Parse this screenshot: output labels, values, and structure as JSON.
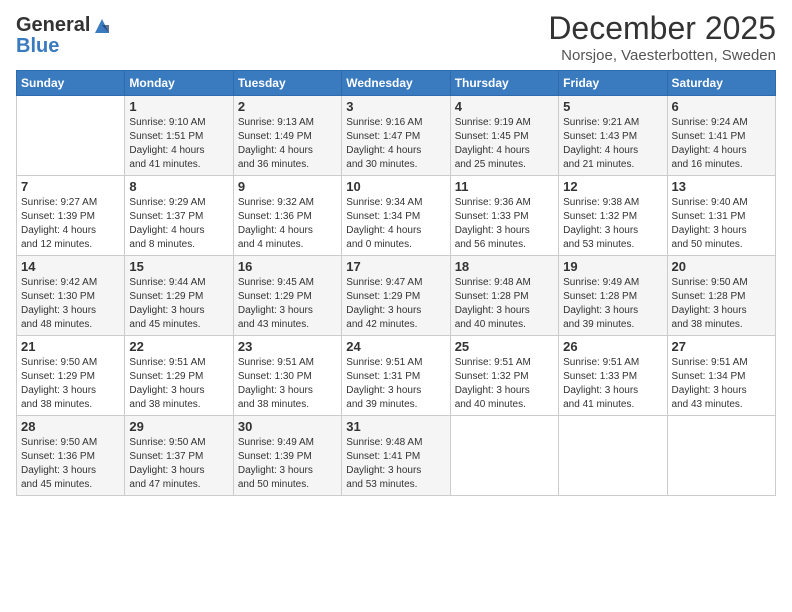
{
  "header": {
    "logo_line1": "General",
    "logo_line2": "Blue",
    "month": "December 2025",
    "location": "Norsjoe, Vaesterbotten, Sweden"
  },
  "columns": [
    "Sunday",
    "Monday",
    "Tuesday",
    "Wednesday",
    "Thursday",
    "Friday",
    "Saturday"
  ],
  "weeks": [
    [
      {
        "day": "",
        "text": ""
      },
      {
        "day": "1",
        "text": "Sunrise: 9:10 AM\nSunset: 1:51 PM\nDaylight: 4 hours\nand 41 minutes."
      },
      {
        "day": "2",
        "text": "Sunrise: 9:13 AM\nSunset: 1:49 PM\nDaylight: 4 hours\nand 36 minutes."
      },
      {
        "day": "3",
        "text": "Sunrise: 9:16 AM\nSunset: 1:47 PM\nDaylight: 4 hours\nand 30 minutes."
      },
      {
        "day": "4",
        "text": "Sunrise: 9:19 AM\nSunset: 1:45 PM\nDaylight: 4 hours\nand 25 minutes."
      },
      {
        "day": "5",
        "text": "Sunrise: 9:21 AM\nSunset: 1:43 PM\nDaylight: 4 hours\nand 21 minutes."
      },
      {
        "day": "6",
        "text": "Sunrise: 9:24 AM\nSunset: 1:41 PM\nDaylight: 4 hours\nand 16 minutes."
      }
    ],
    [
      {
        "day": "7",
        "text": "Sunrise: 9:27 AM\nSunset: 1:39 PM\nDaylight: 4 hours\nand 12 minutes."
      },
      {
        "day": "8",
        "text": "Sunrise: 9:29 AM\nSunset: 1:37 PM\nDaylight: 4 hours\nand 8 minutes."
      },
      {
        "day": "9",
        "text": "Sunrise: 9:32 AM\nSunset: 1:36 PM\nDaylight: 4 hours\nand 4 minutes."
      },
      {
        "day": "10",
        "text": "Sunrise: 9:34 AM\nSunset: 1:34 PM\nDaylight: 4 hours\nand 0 minutes."
      },
      {
        "day": "11",
        "text": "Sunrise: 9:36 AM\nSunset: 1:33 PM\nDaylight: 3 hours\nand 56 minutes."
      },
      {
        "day": "12",
        "text": "Sunrise: 9:38 AM\nSunset: 1:32 PM\nDaylight: 3 hours\nand 53 minutes."
      },
      {
        "day": "13",
        "text": "Sunrise: 9:40 AM\nSunset: 1:31 PM\nDaylight: 3 hours\nand 50 minutes."
      }
    ],
    [
      {
        "day": "14",
        "text": "Sunrise: 9:42 AM\nSunset: 1:30 PM\nDaylight: 3 hours\nand 48 minutes."
      },
      {
        "day": "15",
        "text": "Sunrise: 9:44 AM\nSunset: 1:29 PM\nDaylight: 3 hours\nand 45 minutes."
      },
      {
        "day": "16",
        "text": "Sunrise: 9:45 AM\nSunset: 1:29 PM\nDaylight: 3 hours\nand 43 minutes."
      },
      {
        "day": "17",
        "text": "Sunrise: 9:47 AM\nSunset: 1:29 PM\nDaylight: 3 hours\nand 42 minutes."
      },
      {
        "day": "18",
        "text": "Sunrise: 9:48 AM\nSunset: 1:28 PM\nDaylight: 3 hours\nand 40 minutes."
      },
      {
        "day": "19",
        "text": "Sunrise: 9:49 AM\nSunset: 1:28 PM\nDaylight: 3 hours\nand 39 minutes."
      },
      {
        "day": "20",
        "text": "Sunrise: 9:50 AM\nSunset: 1:28 PM\nDaylight: 3 hours\nand 38 minutes."
      }
    ],
    [
      {
        "day": "21",
        "text": "Sunrise: 9:50 AM\nSunset: 1:29 PM\nDaylight: 3 hours\nand 38 minutes."
      },
      {
        "day": "22",
        "text": "Sunrise: 9:51 AM\nSunset: 1:29 PM\nDaylight: 3 hours\nand 38 minutes."
      },
      {
        "day": "23",
        "text": "Sunrise: 9:51 AM\nSunset: 1:30 PM\nDaylight: 3 hours\nand 38 minutes."
      },
      {
        "day": "24",
        "text": "Sunrise: 9:51 AM\nSunset: 1:31 PM\nDaylight: 3 hours\nand 39 minutes."
      },
      {
        "day": "25",
        "text": "Sunrise: 9:51 AM\nSunset: 1:32 PM\nDaylight: 3 hours\nand 40 minutes."
      },
      {
        "day": "26",
        "text": "Sunrise: 9:51 AM\nSunset: 1:33 PM\nDaylight: 3 hours\nand 41 minutes."
      },
      {
        "day": "27",
        "text": "Sunrise: 9:51 AM\nSunset: 1:34 PM\nDaylight: 3 hours\nand 43 minutes."
      }
    ],
    [
      {
        "day": "28",
        "text": "Sunrise: 9:50 AM\nSunset: 1:36 PM\nDaylight: 3 hours\nand 45 minutes."
      },
      {
        "day": "29",
        "text": "Sunrise: 9:50 AM\nSunset: 1:37 PM\nDaylight: 3 hours\nand 47 minutes."
      },
      {
        "day": "30",
        "text": "Sunrise: 9:49 AM\nSunset: 1:39 PM\nDaylight: 3 hours\nand 50 minutes."
      },
      {
        "day": "31",
        "text": "Sunrise: 9:48 AM\nSunset: 1:41 PM\nDaylight: 3 hours\nand 53 minutes."
      },
      {
        "day": "",
        "text": ""
      },
      {
        "day": "",
        "text": ""
      },
      {
        "day": "",
        "text": ""
      }
    ]
  ]
}
